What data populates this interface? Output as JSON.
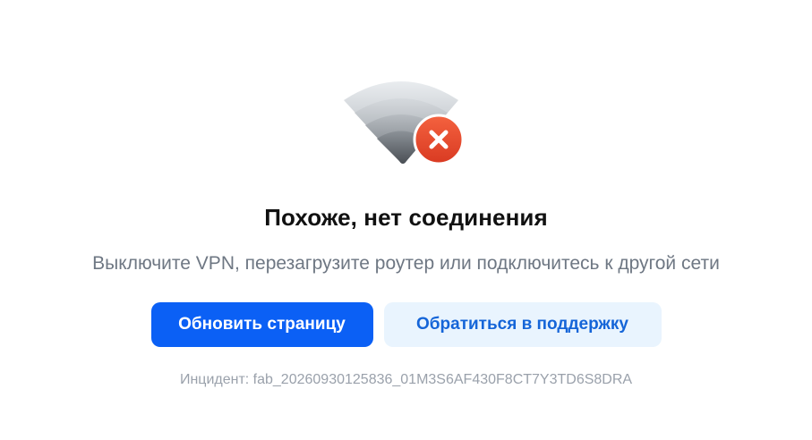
{
  "error": {
    "illustration_icon": "wifi-off-icon",
    "title": "Похоже, нет соединения",
    "subtitle": "Выключите VPN, перезагрузите роутер или подключитесь к другой сети"
  },
  "actions": {
    "refresh_label": "Обновить страницу",
    "support_label": "Обратиться в поддержку"
  },
  "incident": {
    "text": "Инцидент: fab_20260930125836_01M3S6AF430F8CT7Y3TD6S8DRA"
  },
  "colors": {
    "primary": "#0b60f5",
    "secondary_bg": "#e9f4fe",
    "secondary_text": "#1565d8",
    "error_badge": "#e8492e"
  }
}
